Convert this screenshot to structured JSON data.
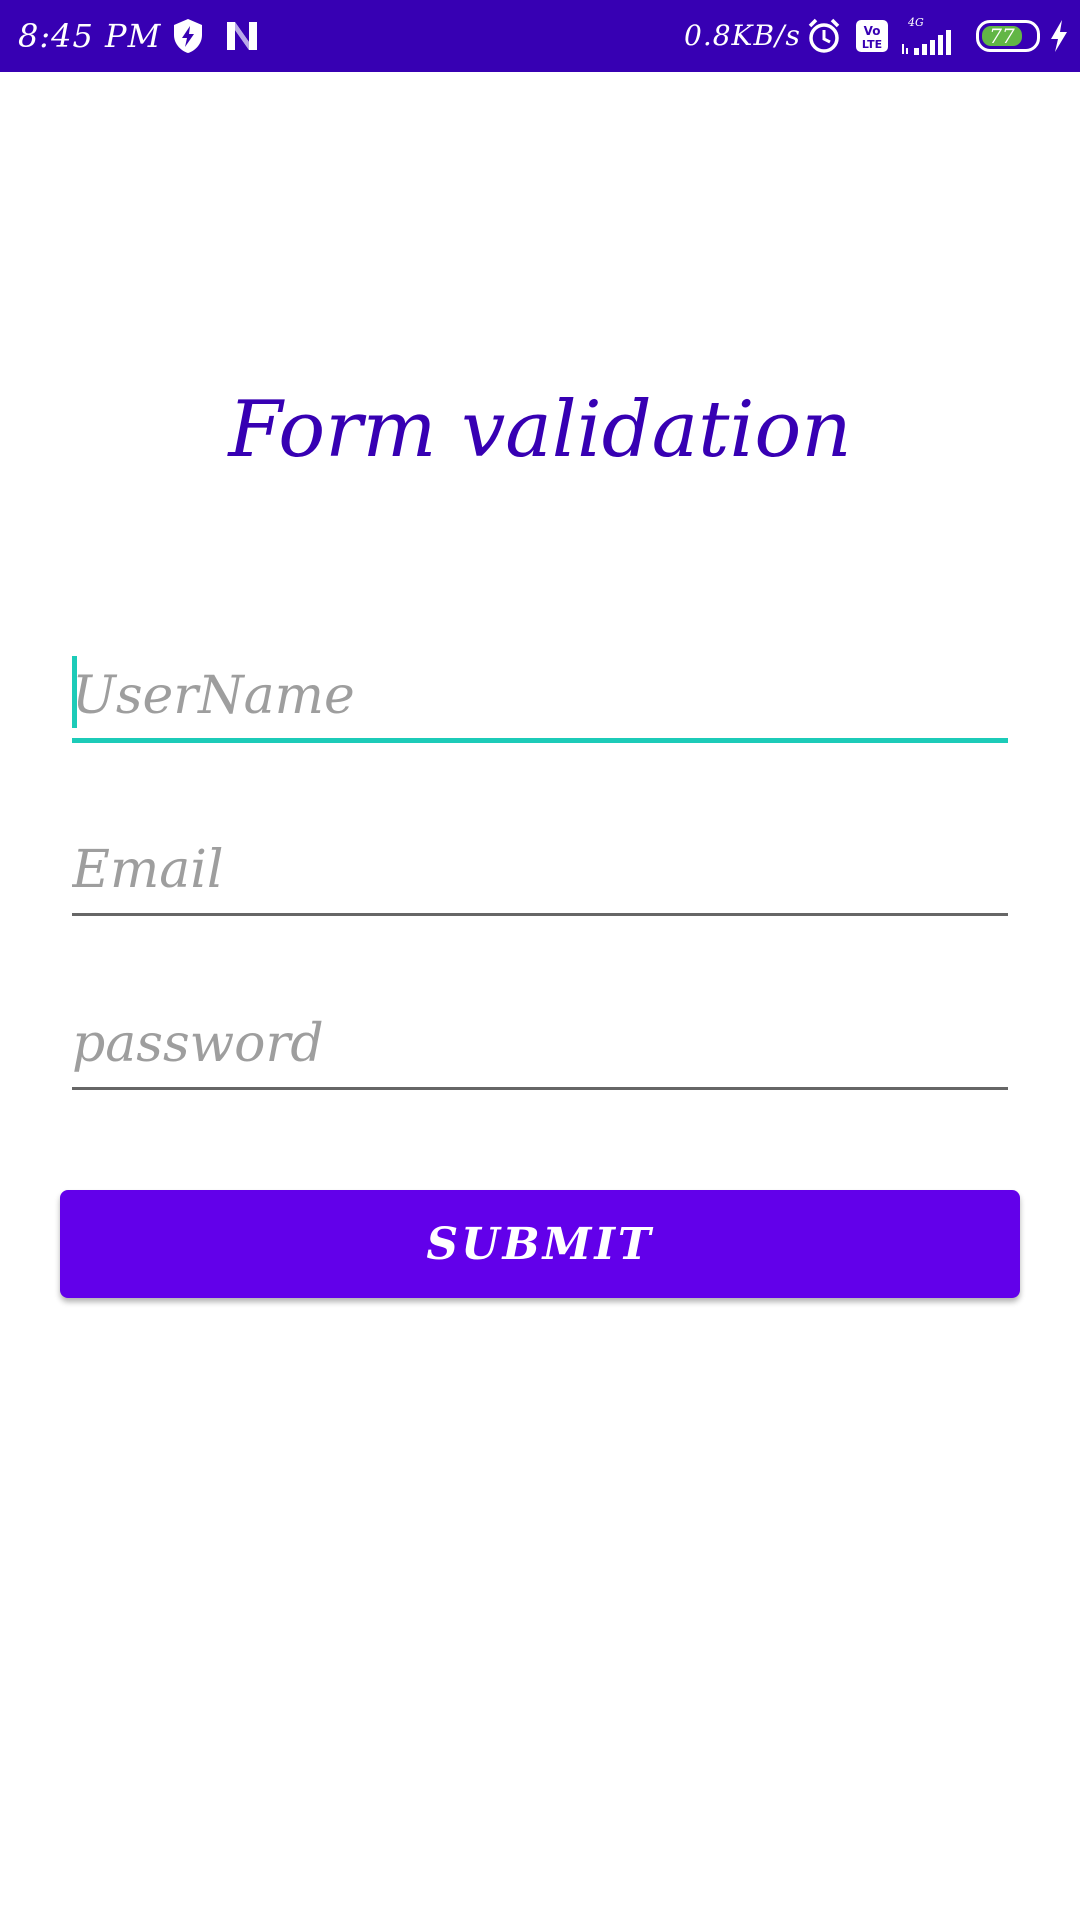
{
  "status_bar": {
    "time": "8:45 PM",
    "net_speed": "0.8KB/s",
    "battery_level": "77",
    "icons": [
      "shield-bolt-icon",
      "n-app-icon",
      "alarm-icon",
      "volte-icon",
      "signal-4g-icon",
      "battery-icon",
      "charging-icon"
    ]
  },
  "page": {
    "title": "Form validation"
  },
  "form": {
    "username": {
      "value": "",
      "placeholder": "UserName"
    },
    "email": {
      "value": "",
      "placeholder": "Email"
    },
    "password": {
      "value": "",
      "placeholder": "password"
    },
    "submit_label": "SUBMIT"
  },
  "colors": {
    "primary_dark": "#3700b3",
    "primary": "#6200ea",
    "accent": "#1ccbb8",
    "hint": "#9e9e9e"
  }
}
